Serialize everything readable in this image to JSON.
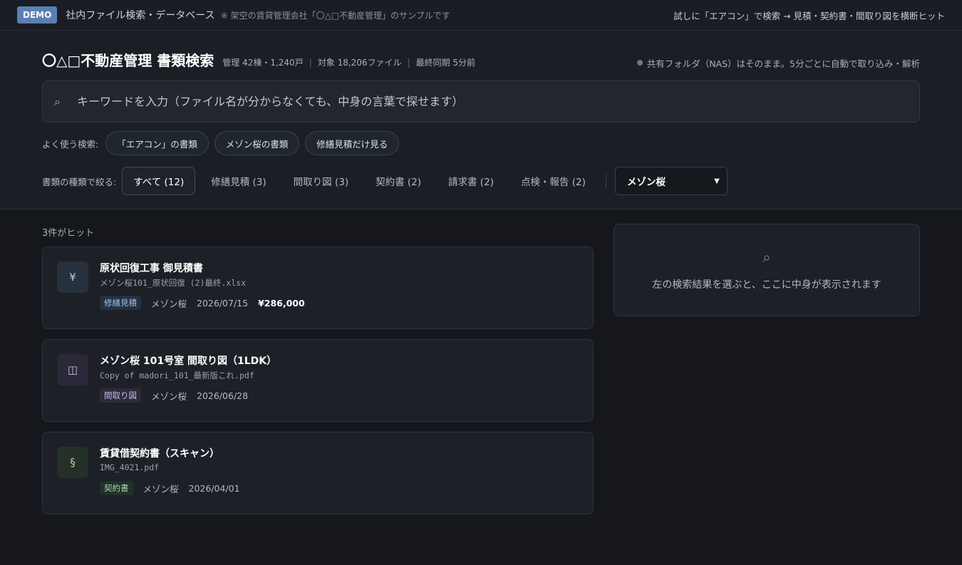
{
  "topbar": {
    "badge": "DEMO",
    "title": "社内ファイル検索・データベース",
    "note": "※ 架空の賃貸管理会社「〇△□不動産管理」のサンプルです",
    "hint": "試しに「エアコン」で検索 → 見積・契約書・間取り図を横断ヒット"
  },
  "header": {
    "title": "〇△□不動産管理 書類検索",
    "stats": [
      "管理 42棟・1,240戸",
      "対象 18,206ファイル",
      "最終同期 5分前"
    ],
    "sync_status": "共有フォルダ（NAS）はそのまま。5分ごとに自動で取り込み・解析"
  },
  "search": {
    "icon": "search-icon",
    "placeholder": "キーワードを入力（ファイル名が分からなくても、中身の言葉で探せます）",
    "value": ""
  },
  "quick": {
    "label": "よく使う検索:",
    "chips": [
      "「エアコン」の書類",
      "メゾン桜の書類",
      "修繕見積だけ見る"
    ]
  },
  "types": {
    "label": "書類の種類で絞る:",
    "tabs": [
      "すべて (12)",
      "修繕見積 (3)",
      "間取り図 (3)",
      "契約書 (2)",
      "請求書 (2)",
      "点検・報告 (2)"
    ],
    "active_index": 0,
    "building_select": "メゾン桜"
  },
  "results": {
    "count_text": "3件がヒット",
    "items": [
      {
        "icon": "¥",
        "title": "原状回復工事 御見積書",
        "file": "メゾン桜101_原状回復 (2)最終.xlsx",
        "tag": "修繕見積",
        "building": "メゾン桜",
        "date": "2026/07/15",
        "price": "¥286,000"
      },
      {
        "icon": "◫",
        "title": "メゾン桜 101号室 間取り図（1LDK）",
        "file": "Copy of madori_101_最新版これ.pdf",
        "tag": "間取り図",
        "building": "メゾン桜",
        "date": "2026/06/28"
      },
      {
        "icon": "§",
        "title": "賃貸借契約書（スキャン）",
        "file": "IMG_4021.pdf",
        "tag": "契約書",
        "building": "メゾン桜",
        "date": "2026/04/01"
      }
    ]
  },
  "preview": {
    "text": "左の検索結果を選ぶと、ここに中身が表示されます"
  },
  "colors": {
    "accent": "#5b7fb5",
    "background": "#15171c",
    "panel": "#1d2027"
  }
}
